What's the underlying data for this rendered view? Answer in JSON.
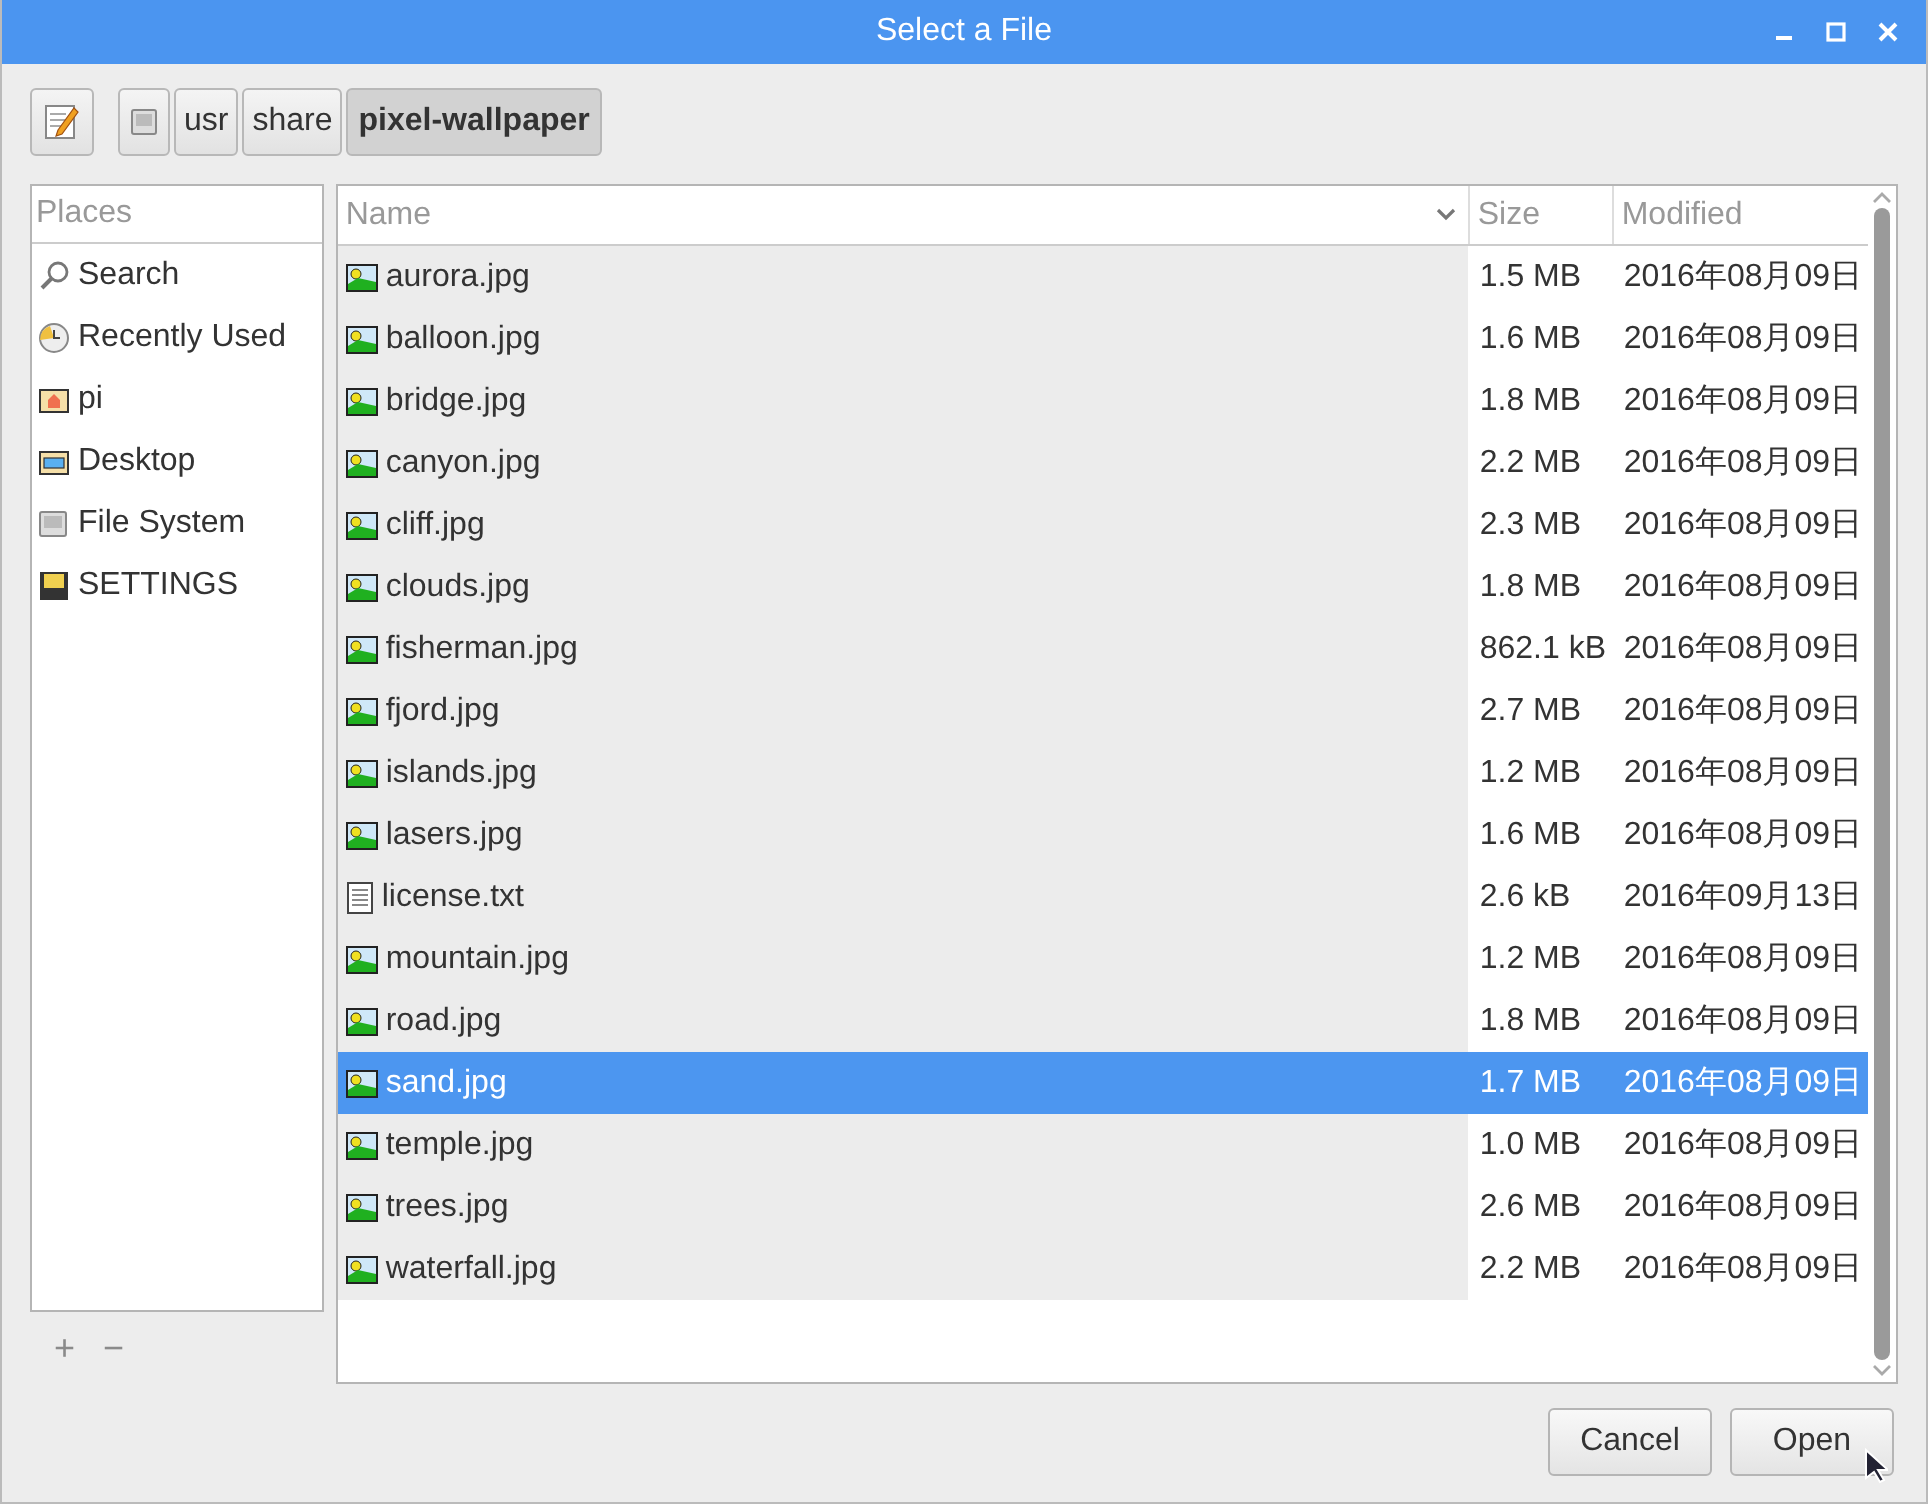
{
  "window": {
    "title": "Select a File"
  },
  "path_bar": [
    {
      "kind": "drive",
      "selected": false
    },
    {
      "kind": "folder",
      "label": "usr",
      "selected": false
    },
    {
      "kind": "folder",
      "label": "share",
      "selected": false
    },
    {
      "kind": "folder",
      "label": "pixel-wallpaper",
      "selected": true
    }
  ],
  "places": {
    "header": "Places",
    "items": [
      {
        "kind": "search",
        "label": "Search"
      },
      {
        "kind": "recent",
        "label": "Recently Used"
      },
      {
        "kind": "home",
        "label": "pi"
      },
      {
        "kind": "desktop",
        "label": "Desktop"
      },
      {
        "kind": "drive",
        "label": "File System"
      },
      {
        "kind": "floppy",
        "label": "SETTINGS"
      }
    ],
    "add": "+",
    "remove": "−"
  },
  "table": {
    "columns": [
      "Name",
      "Size",
      "Modified"
    ],
    "rows": [
      {
        "kind": "image",
        "name": "aurora.jpg",
        "size": "1.5 MB",
        "modified": "2016年08月09日",
        "selected": false
      },
      {
        "kind": "image",
        "name": "balloon.jpg",
        "size": "1.6 MB",
        "modified": "2016年08月09日",
        "selected": false
      },
      {
        "kind": "image",
        "name": "bridge.jpg",
        "size": "1.8 MB",
        "modified": "2016年08月09日",
        "selected": false
      },
      {
        "kind": "image",
        "name": "canyon.jpg",
        "size": "2.2 MB",
        "modified": "2016年08月09日",
        "selected": false
      },
      {
        "kind": "image",
        "name": "cliff.jpg",
        "size": "2.3 MB",
        "modified": "2016年08月09日",
        "selected": false
      },
      {
        "kind": "image",
        "name": "clouds.jpg",
        "size": "1.8 MB",
        "modified": "2016年08月09日",
        "selected": false
      },
      {
        "kind": "image",
        "name": "fisherman.jpg",
        "size": "862.1 kB",
        "modified": "2016年08月09日",
        "selected": false
      },
      {
        "kind": "image",
        "name": "fjord.jpg",
        "size": "2.7 MB",
        "modified": "2016年08月09日",
        "selected": false
      },
      {
        "kind": "image",
        "name": "islands.jpg",
        "size": "1.2 MB",
        "modified": "2016年08月09日",
        "selected": false
      },
      {
        "kind": "image",
        "name": "lasers.jpg",
        "size": "1.6 MB",
        "modified": "2016年08月09日",
        "selected": false
      },
      {
        "kind": "text",
        "name": "license.txt",
        "size": "2.6 kB",
        "modified": "2016年09月13日",
        "selected": false
      },
      {
        "kind": "image",
        "name": "mountain.jpg",
        "size": "1.2 MB",
        "modified": "2016年08月09日",
        "selected": false
      },
      {
        "kind": "image",
        "name": "road.jpg",
        "size": "1.8 MB",
        "modified": "2016年08月09日",
        "selected": false
      },
      {
        "kind": "image",
        "name": "sand.jpg",
        "size": "1.7 MB",
        "modified": "2016年08月09日",
        "selected": true
      },
      {
        "kind": "image",
        "name": "temple.jpg",
        "size": "1.0 MB",
        "modified": "2016年08月09日",
        "selected": false
      },
      {
        "kind": "image",
        "name": "trees.jpg",
        "size": "2.6 MB",
        "modified": "2016年08月09日",
        "selected": false
      },
      {
        "kind": "image",
        "name": "waterfall.jpg",
        "size": "2.2 MB",
        "modified": "2016年08月09日",
        "selected": false
      }
    ]
  },
  "buttons": [
    "Cancel",
    "Open"
  ]
}
